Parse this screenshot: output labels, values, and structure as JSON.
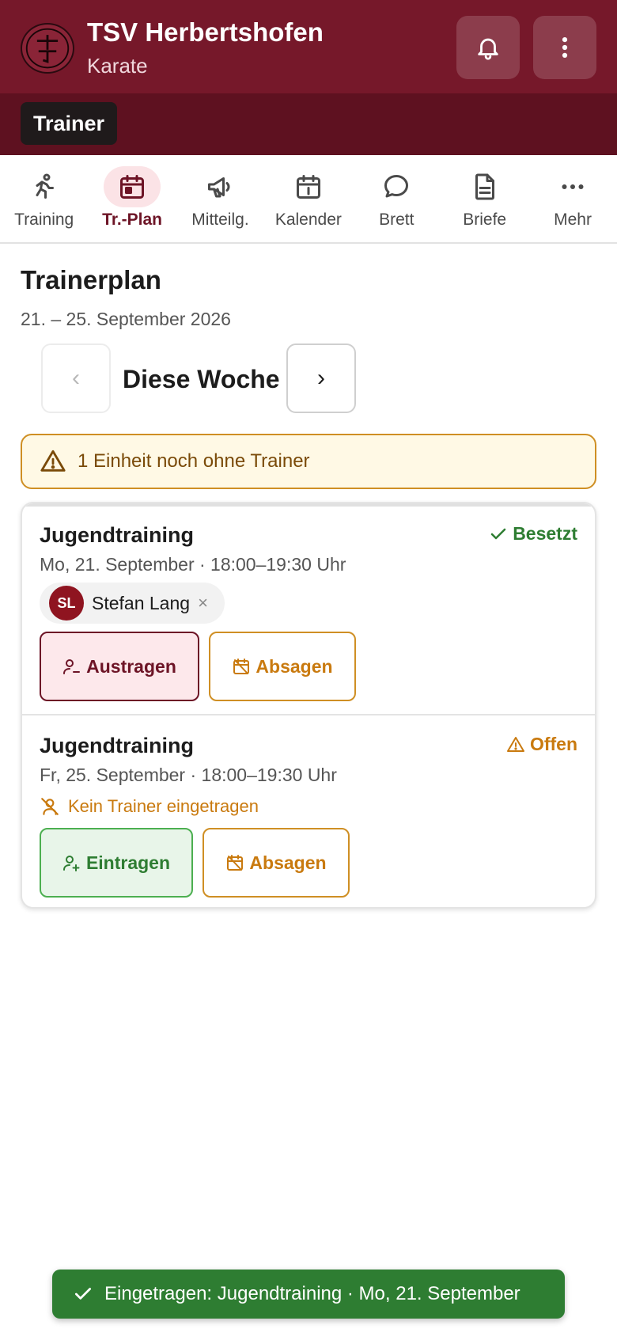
{
  "header": {
    "club_name": "TSV Herbertshofen",
    "department": "Karate",
    "notifications_icon": "bell-icon",
    "menu_icon": "more-vertical-icon"
  },
  "role": {
    "label": "Trainer"
  },
  "tabs": [
    {
      "label": "Training",
      "icon": "running-icon",
      "active": false
    },
    {
      "label": "Tr.-Plan",
      "icon": "calendar-grid-icon",
      "active": true
    },
    {
      "label": "Mitteilg.",
      "icon": "megaphone-icon",
      "active": false
    },
    {
      "label": "Kalender",
      "icon": "calendar-icon",
      "active": false
    },
    {
      "label": "Brett",
      "icon": "chat-bubble-icon",
      "active": false
    },
    {
      "label": "Briefe",
      "icon": "document-icon",
      "active": false
    },
    {
      "label": "Mehr",
      "icon": "more-horizontal-icon",
      "active": false
    }
  ],
  "page": {
    "title": "Trainerplan",
    "date_range": "21. – 25. September 2026",
    "week_label": "Diese Woche",
    "prev_symbol": "‹",
    "next_symbol": "›"
  },
  "warning": {
    "text": "1 Einheit noch ohne Trainer"
  },
  "sessions": [
    {
      "title": "Jugendtraining",
      "date": "Mo, 21. September · 18:00–19:30 Uhr",
      "status": "Besetzt",
      "trainer": {
        "initials": "SL",
        "name": "Stefan Lang",
        "remove_symbol": "×"
      },
      "primary_action": "Austragen",
      "secondary_action": "Absagen"
    },
    {
      "title": "Jugendtraining",
      "date": "Fr, 25. September · 18:00–19:30 Uhr",
      "status": "Offen",
      "no_trainer_text": "Kein Trainer eingetragen",
      "primary_action": "Eintragen",
      "secondary_action": "Absagen"
    }
  ],
  "toast": {
    "text": "Eingetragen: Jugendtraining · Mo, 21. September"
  },
  "colors": {
    "header_bg": "#76182a",
    "role_bar_bg": "#5e1120",
    "accent": "#6d1426",
    "success": "#2e7d32",
    "warning": "#c97a0f"
  }
}
